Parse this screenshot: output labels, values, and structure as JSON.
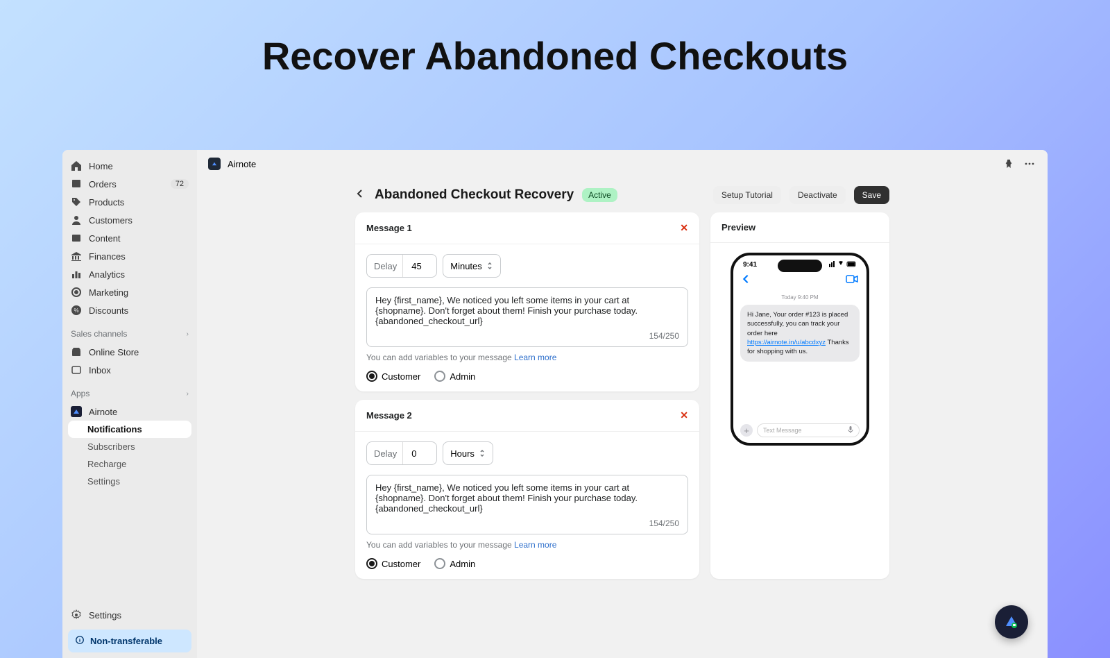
{
  "hero": {
    "title": "Recover Abandoned Checkouts"
  },
  "app": {
    "name": "Airnote"
  },
  "sidebar": {
    "items": [
      {
        "label": "Home"
      },
      {
        "label": "Orders",
        "badge": "72"
      },
      {
        "label": "Products"
      },
      {
        "label": "Customers"
      },
      {
        "label": "Content"
      },
      {
        "label": "Finances"
      },
      {
        "label": "Analytics"
      },
      {
        "label": "Marketing"
      },
      {
        "label": "Discounts"
      }
    ],
    "salesChannels": {
      "label": "Sales channels",
      "items": [
        {
          "label": "Online Store"
        },
        {
          "label": "Inbox"
        }
      ]
    },
    "apps": {
      "label": "Apps",
      "items": [
        {
          "label": "Airnote",
          "sub": [
            {
              "label": "Notifications",
              "active": true
            },
            {
              "label": "Subscribers"
            },
            {
              "label": "Recharge"
            },
            {
              "label": "Settings"
            }
          ]
        }
      ]
    },
    "settings": "Settings",
    "nontransferable": "Non-transferable"
  },
  "header": {
    "title": "Abandoned Checkout Recovery",
    "status": "Active",
    "setupTutorial": "Setup Tutorial",
    "deactivate": "Deactivate",
    "save": "Save"
  },
  "messages": [
    {
      "title": "Message 1",
      "delayLabel": "Delay",
      "delayValue": "45",
      "unit": "Minutes",
      "text": "Hey {first_name}, We noticed you left some items in your cart at {shopname}. Don't forget about them! Finish your purchase today. {abandoned_checkout_url}",
      "counter": "154/250",
      "hint": "You can add variables to your message ",
      "learnMore": "Learn more",
      "customer": "Customer",
      "admin": "Admin"
    },
    {
      "title": "Message 2",
      "delayLabel": "Delay",
      "delayValue": "0",
      "unit": "Hours",
      "text": "Hey {first_name}, We noticed you left some items in your cart at {shopname}. Don't forget about them! Finish your purchase today. {abandoned_checkout_url}",
      "counter": "154/250",
      "hint": "You can add variables to your message ",
      "learnMore": "Learn more",
      "customer": "Customer",
      "admin": "Admin"
    }
  ],
  "preview": {
    "title": "Preview",
    "phone": {
      "time": "9:41",
      "dateLabel": "Today 9:40 PM",
      "bubbleBefore": "Hi Jane, Your order #123 is placed successfully, you can track your order here ",
      "bubbleLink": "https://airnote.in/u/abcdxyz",
      "bubbleAfter": " Thanks for shopping with us.",
      "composePlaceholder": "Text Message"
    }
  }
}
